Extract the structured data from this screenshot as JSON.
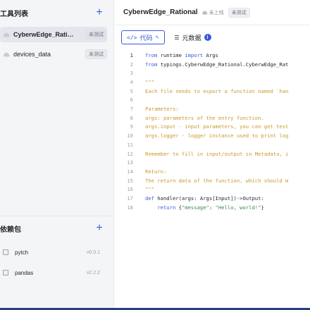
{
  "sidebar": {
    "tools_title": "工具列表",
    "tools": [
      {
        "name": "CyberwEdge_Rational",
        "display": "CyberwEdge_Rati…",
        "badge": "未测试",
        "active": true
      },
      {
        "name": "devices_data",
        "display": "devices_data",
        "badge": "未测试",
        "active": false
      }
    ],
    "deps_title": "依赖包",
    "deps": [
      {
        "name": "pytch",
        "version": "v0.0.1"
      },
      {
        "name": "pandas",
        "version": "v2.2.2"
      }
    ]
  },
  "header": {
    "title": "CyberwEdge_Rational",
    "status": "未上线",
    "badge": "未测试"
  },
  "tabs": [
    {
      "label": "代码",
      "icon": "</>",
      "active": true
    },
    {
      "label": "元数据",
      "icon": "list-icon",
      "active": false
    }
  ],
  "code_lines": [
    {
      "n": "1",
      "t": "from runtime import Args"
    },
    {
      "n": "2",
      "t": "from typings.CyberwEdge_Rational.CyberwEdge_Rat"
    },
    {
      "n": "3",
      "t": ""
    },
    {
      "n": "4",
      "t": "\"\"\""
    },
    {
      "n": "5",
      "t": "Each file needs to export a function named `han"
    },
    {
      "n": "6",
      "t": ""
    },
    {
      "n": "7",
      "t": "Parameters:"
    },
    {
      "n": "8",
      "t": "args: parameters of the entry function."
    },
    {
      "n": "9",
      "t": "args.input - input parameters, you can get test"
    },
    {
      "n": "10",
      "t": "args.logger - logger instance used to print log"
    },
    {
      "n": "11",
      "t": ""
    },
    {
      "n": "12",
      "t": "Remember to fill in input/output in Metadata, i"
    },
    {
      "n": "13",
      "t": ""
    },
    {
      "n": "14",
      "t": "Return:"
    },
    {
      "n": "15",
      "t": "The return data of the function, which should m"
    },
    {
      "n": "16",
      "t": "\"\"\""
    },
    {
      "n": "17",
      "t": "def handler(args: Args[Input])->Output:"
    },
    {
      "n": "18",
      "t": "    return {\"message\": \"Hello, world!\"}"
    }
  ],
  "colors": {
    "accent": "#3a5bd9",
    "comment": "#c99a2e",
    "string": "#3d8a4a"
  }
}
